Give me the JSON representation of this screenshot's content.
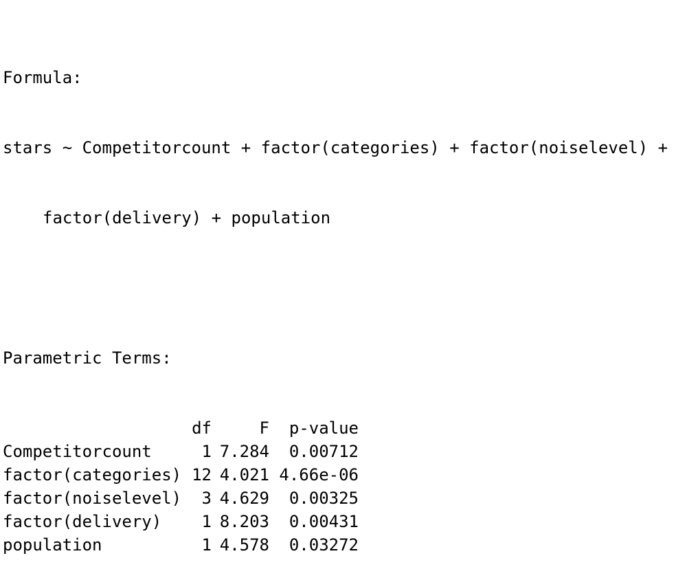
{
  "formula": {
    "label": "Formula:",
    "line1": "stars ~ Competitorcount + factor(categories) + factor(noiselevel) +",
    "line2": "factor(delivery) + population"
  },
  "parametric": {
    "label": "Parametric Terms:",
    "headers": {
      "term": "",
      "df": "df",
      "f": "F",
      "p": "p-value"
    },
    "rows": [
      {
        "term": "Competitorcount",
        "df": "1",
        "f": "7.284",
        "p": "0.00712"
      },
      {
        "term": "factor(categories)",
        "df": "12",
        "f": "4.021",
        "p": "4.66e-06"
      },
      {
        "term": "factor(noiselevel)",
        "df": "3",
        "f": "4.629",
        "p": "0.00325"
      },
      {
        "term": "factor(delivery)",
        "df": "1",
        "f": "8.203",
        "p": "0.00431"
      },
      {
        "term": "population",
        "df": "1",
        "f": "4.578",
        "p": "0.03272"
      }
    ]
  }
}
